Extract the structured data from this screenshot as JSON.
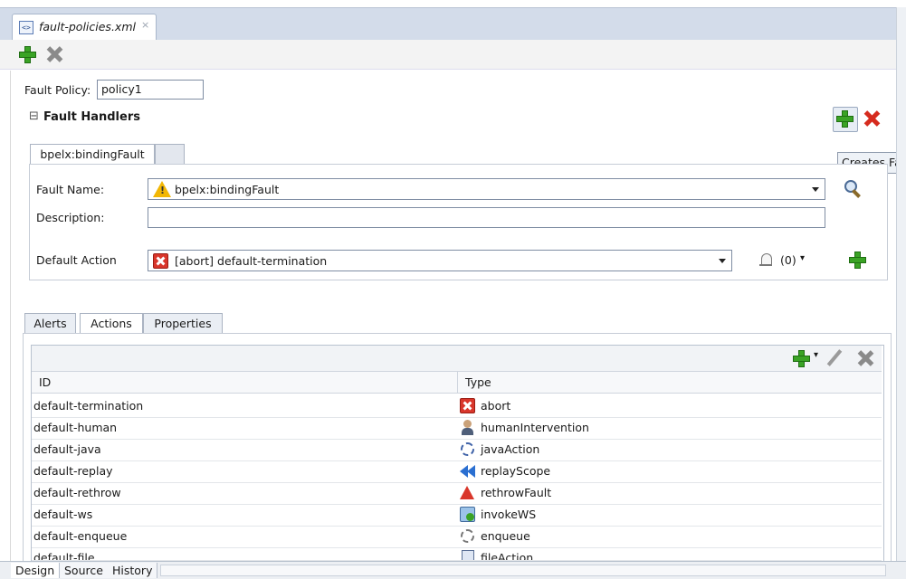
{
  "editor_tab": {
    "file_name": "fault-policies.xml",
    "close_glyph": "×",
    "file_icon": "xml-file-icon",
    "file_icon_text": "<>"
  },
  "toolbar": {
    "add_icon": "add-icon",
    "delete_icon": "delete-icon"
  },
  "fault_policy": {
    "label": "Fault Policy:",
    "value": "policy1"
  },
  "fault_handlers": {
    "section_title": "Fault Handlers",
    "collapse_glyph": "⊟",
    "tooltip": "Creates Fau",
    "handler_tab": "bpelx:bindingFault",
    "fault_name": {
      "label": "Fault Name:",
      "value": "bpelx:bindingFault",
      "icon": "warning-icon"
    },
    "description": {
      "label": "Description:",
      "value": ""
    },
    "default_action": {
      "label": "Default Action",
      "value": "[abort] default-termination",
      "icon": "abort-icon"
    },
    "alerts_count": "(0)",
    "alerts_caret": "▾"
  },
  "tabs": [
    {
      "label": "Alerts"
    },
    {
      "label": "Actions",
      "active": true
    },
    {
      "label": "Properties"
    }
  ],
  "actions_table": {
    "columns": [
      "ID",
      "Type"
    ],
    "rows": [
      {
        "id": "default-termination",
        "type": "abort",
        "icon": "abort-icon"
      },
      {
        "id": "default-human",
        "type": "humanIntervention",
        "icon": "person-icon"
      },
      {
        "id": "default-java",
        "type": "javaAction",
        "icon": "gear-icon"
      },
      {
        "id": "default-replay",
        "type": "replayScope",
        "icon": "replay-icon"
      },
      {
        "id": "default-rethrow",
        "type": "rethrowFault",
        "icon": "rethrow-icon"
      },
      {
        "id": "default-ws",
        "type": "invokeWS",
        "icon": "web-service-icon"
      },
      {
        "id": "default-enqueue",
        "type": "enqueue",
        "icon": "queue-icon"
      },
      {
        "id": "default-file",
        "type": "fileAction",
        "icon": "file-icon"
      }
    ],
    "dropdown_caret": "▾"
  },
  "bottom_tabs": [
    {
      "label": "Design",
      "active": true
    },
    {
      "label": "Source"
    },
    {
      "label": "History"
    }
  ],
  "colors": {
    "accent_green": "#3aa325",
    "delete_red": "#d62b1e",
    "tabstrip": "#d3dcea"
  }
}
